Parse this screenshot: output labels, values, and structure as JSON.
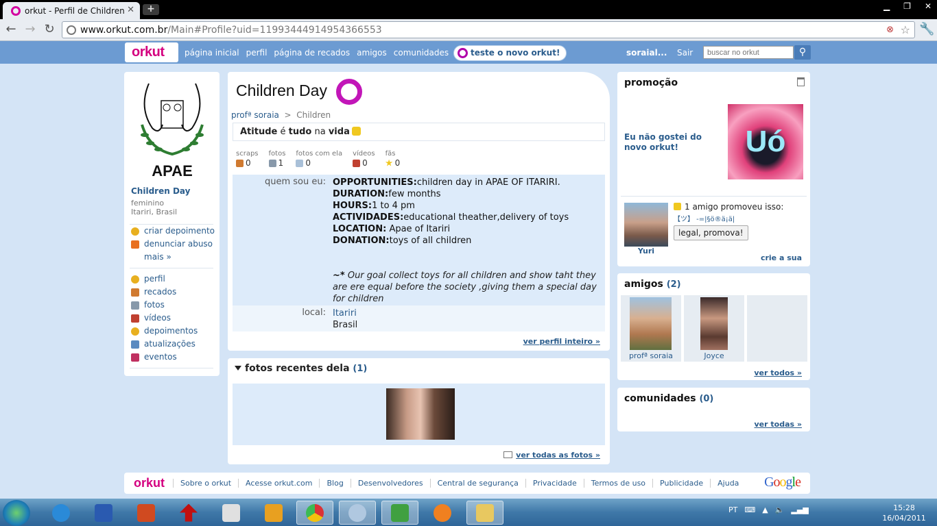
{
  "browser": {
    "tab_title": "orkut - Perfil de Children",
    "new_tab": "+",
    "url_host": "www.orkut.com.br",
    "url_path": "/Main#Profile?uid=11993444914954366553"
  },
  "topbar": {
    "logo": "orkut",
    "nav": [
      "página inicial",
      "perfil",
      "página de recados",
      "amigos",
      "comunidades"
    ],
    "try_new": "teste o novo orkut!",
    "user": "soraial...",
    "logout": "Sair",
    "search_placeholder": "buscar no orkut"
  },
  "left": {
    "logo_text": "APAE",
    "name": "Children Day",
    "gender": "feminino",
    "location": "Itariri, Brasil",
    "actions": [
      "criar depoimento",
      "denunciar abuso",
      "mais »"
    ],
    "menu": [
      "perfil",
      "recados",
      "fotos",
      "vídeos",
      "depoimentos",
      "atualizações",
      "eventos"
    ]
  },
  "profile": {
    "title": "Children Day",
    "breadcrumb_parent": "profª soraia",
    "breadcrumb_sep": ">",
    "breadcrumb_current": "Children",
    "motto": {
      "w1": "Atitude",
      "w2": "é",
      "w3": "tudo",
      "w4": "na",
      "w5": "vida"
    },
    "stats": [
      {
        "label": "scraps",
        "value": "0"
      },
      {
        "label": "fotos",
        "value": "1"
      },
      {
        "label": "fotos com ela",
        "value": "0"
      },
      {
        "label": "vídeos",
        "value": "0"
      },
      {
        "label": "fãs",
        "value": "0"
      }
    ],
    "about_label": "quem sou eu:",
    "about": {
      "l1k": "OPPORTUNITIES:",
      "l1v": "children day in APAE OF ITARIRI.",
      "l2k": "DURATION:",
      "l2v": "few months",
      "l3k": "HOURS:",
      "l3v": "1 to 4 pm",
      "l4k": "ACTIVIDADES:",
      "l4v": "educational theather,delivery of toys",
      "l5k": "LOCATION:",
      "l5v": " Apae of Itariri",
      "l6k": "DONATION:",
      "l6v": "toys of all children",
      "goal_prefix": "~*",
      "goal": " Our goal collect toys for all children and show taht they are ere equal before the society ,giving them a special day for children"
    },
    "local_label": "local:",
    "local_city": "Itariri",
    "local_country": "Brasil",
    "view_full": "ver perfil inteiro »"
  },
  "photos": {
    "title": "fotos recentes dela",
    "count": "(1)",
    "view_all": "ver todas as fotos »"
  },
  "promo": {
    "title": "promoção",
    "text": "Eu não gostei do novo orkut!",
    "image_text": "Uó",
    "friend_name": "Yuri",
    "promoted_text": "1 amigo promoveu isso:",
    "promoted_nick": "【ツ】 -=|§ö®ä¡ä|",
    "button": "legal, promova!",
    "create": "crie a sua"
  },
  "friends": {
    "title": "amigos",
    "count": "(2)",
    "list": [
      {
        "name": "profª soraia"
      },
      {
        "name": "Joyce"
      }
    ],
    "view_all": "ver todos »"
  },
  "communities": {
    "title": "comunidades",
    "count": "(0)",
    "view_all": "ver todas »"
  },
  "footer": {
    "logo": "orkut",
    "links": [
      "Sobre o orkut",
      "Acesse orkut.com",
      "Blog",
      "Desenvolvedores",
      "Central de segurança",
      "Privacidade",
      "Termos de uso",
      "Publicidade",
      "Ajuda"
    ],
    "google": "Google"
  },
  "taskbar": {
    "lang": "PT",
    "time": "15:28",
    "date": "16/04/2011"
  },
  "colors": {
    "orkut_pink": "#d4007f",
    "link_blue": "#2a5c8c",
    "page_bg": "#d4e4f6",
    "topbar_blue": "#6c9bd2"
  }
}
